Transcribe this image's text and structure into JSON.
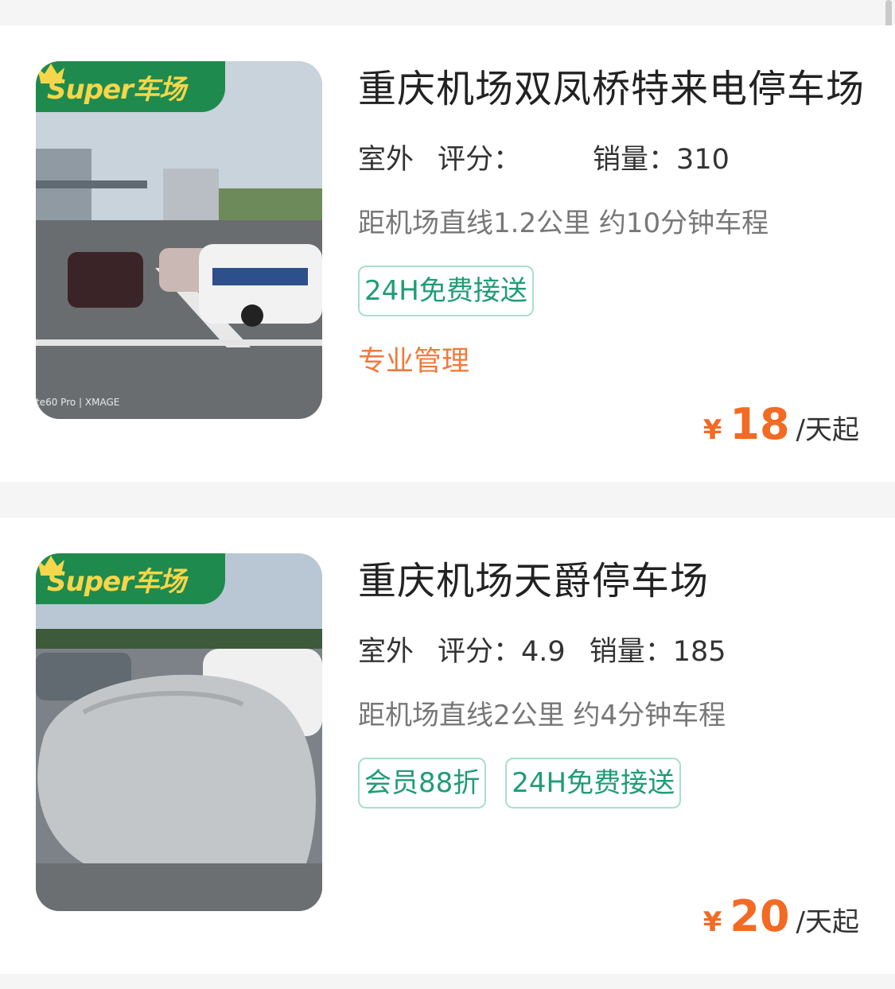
{
  "listings": [
    {
      "badge": "Super车场",
      "title": "重庆机场双凤桥特来电停车场",
      "type_tag": "室外",
      "rating_label": "评分：",
      "rating_value": "",
      "sales_label": "销量：",
      "sales_value": "310",
      "distance": "距机场直线1.2公里 约10分钟车程",
      "chips": [
        "24H免费接送"
      ],
      "highlight": "专业管理",
      "price_symbol": "¥",
      "price": "18",
      "price_unit": "/天起",
      "photo_watermark": "te60 Pro | XMAGE"
    },
    {
      "badge": "Super车场",
      "title": "重庆机场天爵停车场",
      "type_tag": "室外",
      "rating_label": "评分：",
      "rating_value": "4.9",
      "sales_label": "销量：",
      "sales_value": "185",
      "distance": "距机场直线2公里 约4分钟车程",
      "chips": [
        "会员88折",
        "24H免费接送"
      ],
      "price_symbol": "¥",
      "price": "20",
      "price_unit": "/天起"
    }
  ],
  "colors": {
    "badge_green": "#1f8a4d",
    "badge_text": "#f6d64a",
    "chip_text": "#1f9d72",
    "price_orange": "#f36a22",
    "highlight_orange": "#f07a3c"
  }
}
